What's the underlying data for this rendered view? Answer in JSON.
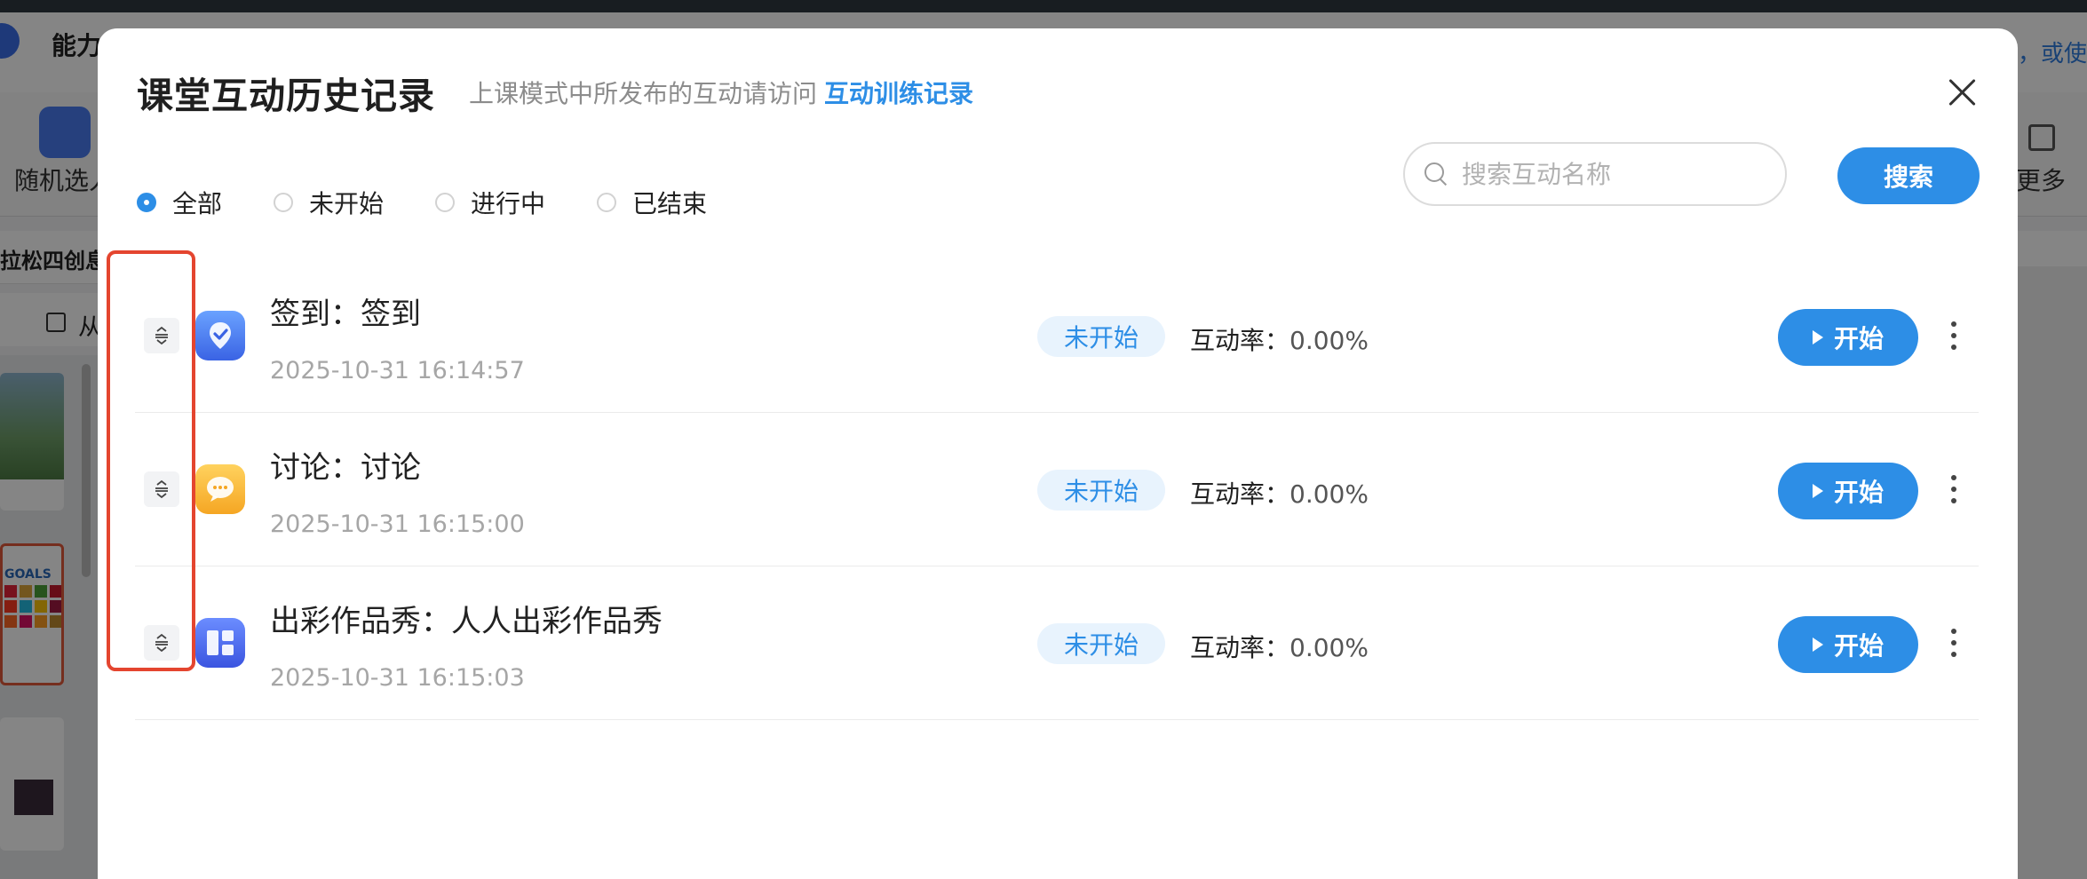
{
  "background": {
    "app_title": "能力",
    "hint_text": "，或使",
    "toolbar_left_label": "随机选人",
    "toolbar_right_label": "更多",
    "subbar_text": "拉松四创息",
    "row2_text": "从",
    "thumb_text": "GOALS"
  },
  "modal": {
    "title": "课堂互动历史记录",
    "subtitle": "上课模式中所发布的互动请访问",
    "subtitle_link": "互动训练记录",
    "close_icon": "close-icon"
  },
  "filters": [
    {
      "label": "全部",
      "checked": true
    },
    {
      "label": "未开始",
      "checked": false
    },
    {
      "label": "进行中",
      "checked": false
    },
    {
      "label": "已结束",
      "checked": false
    }
  ],
  "search": {
    "placeholder": "搜索互动名称",
    "button_label": "搜索"
  },
  "items": [
    {
      "icon": "sign-in-icon",
      "title": "签到：签到",
      "time": "2025-10-31 16:14:57",
      "status": "未开始",
      "rate_label": "互动率：",
      "rate_value": "0.00%",
      "action": "开始"
    },
    {
      "icon": "discussion-icon",
      "title": "讨论：讨论",
      "time": "2025-10-31 16:15:00",
      "status": "未开始",
      "rate_label": "互动率：",
      "rate_value": "0.00%",
      "action": "开始"
    },
    {
      "icon": "showcase-icon",
      "title": "出彩作品秀：人人出彩作品秀",
      "time": "2025-10-31 16:15:03",
      "status": "未开始",
      "rate_label": "互动率：",
      "rate_value": "0.00%",
      "action": "开始"
    }
  ],
  "colors": {
    "accent": "#2d8ee6",
    "highlight": "#e4452f",
    "badge_bg": "#e8f3fd"
  }
}
